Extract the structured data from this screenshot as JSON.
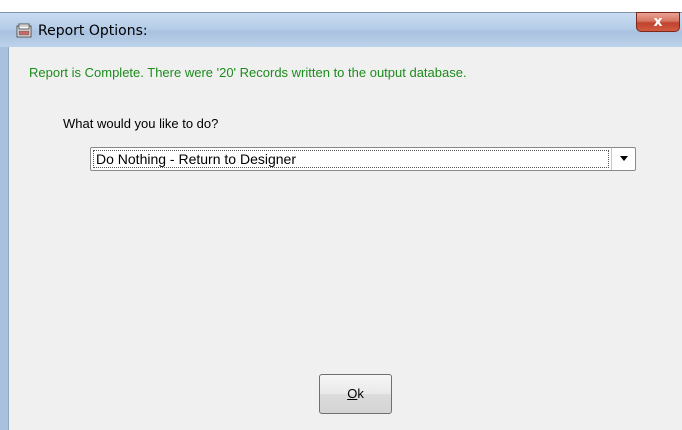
{
  "window": {
    "title": "Report Options:",
    "close_label": "x"
  },
  "dialog": {
    "status_message": "Report is Complete.  There were '20' Records written to the output database.",
    "prompt": "What would you like to do?",
    "action_select": {
      "selected_value": "Do Nothing - Return to Designer"
    },
    "ok_button": {
      "mnemonic": "O",
      "rest": "k"
    }
  },
  "colors": {
    "status_text": "#1c8c1c",
    "client_background": "#f0f0f0",
    "close_button": "#c0432d"
  }
}
